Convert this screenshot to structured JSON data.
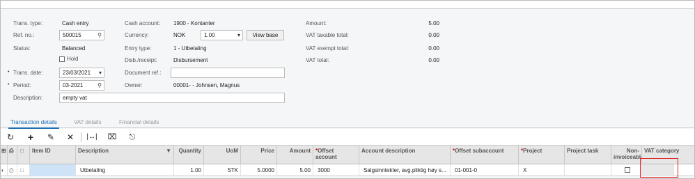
{
  "header": {
    "trans_type_label": "Trans. type:",
    "trans_type_value": "Cash entry",
    "ref_no_label": "Ref. no.:",
    "ref_no_value": "500015",
    "status_label": "Status:",
    "status_value": "Balanced",
    "hold_label": "Hold",
    "trans_date_label": "Trans. date:",
    "trans_date_value": "23/03/2021",
    "period_label": "Period:",
    "period_value": "03-2021",
    "description_label": "Description:",
    "description_value": "empty vat",
    "cash_account_label": "Cash account:",
    "cash_account_value": "1900 - Kontanter",
    "currency_label": "Currency:",
    "currency_value": "NOK",
    "currency_rate": "1.00",
    "view_base_label": "View base",
    "entry_type_label": "Entry type:",
    "entry_type_value": "1 - Utbetaling",
    "disb_receipt_label": "Disb./receipt:",
    "disb_receipt_value": "Disbursement",
    "document_ref_label": "Document ref.:",
    "document_ref_value": "",
    "owner_label": "Owner:",
    "owner_value": "00001- - Johnsen, Magnus"
  },
  "totals": {
    "amount_label": "Amount:",
    "amount_value": "5.00",
    "vat_taxable_label": "VAT taxable total:",
    "vat_taxable_value": "0.00",
    "vat_exempt_label": "VAT exempt total:",
    "vat_exempt_value": "0.00",
    "vat_total_label": "VAT total:",
    "vat_total_value": "0.00"
  },
  "tabs": [
    {
      "label": "Transaction details",
      "active": true
    },
    {
      "label": "VAT details",
      "active": false
    },
    {
      "label": "Financial details",
      "active": false
    }
  ],
  "toolbar": {
    "icons": [
      "refresh-icon",
      "add-icon",
      "edit-icon",
      "delete-icon",
      "fit-width-icon",
      "export-excel-icon",
      "upload-icon"
    ]
  },
  "grid": {
    "columns": {
      "item_id": "Item ID",
      "description": "Description",
      "quantity": "Quantity",
      "uom": "UoM",
      "price": "Price",
      "amount": "Amount",
      "offset_account": "Offset account",
      "account_description": "Account description",
      "offset_subaccount": "Offset subaccount",
      "project": "Project",
      "project_task": "Project task",
      "non_invoiceable": "Non-invoiceable",
      "vat_category": "VAT category"
    },
    "rows": [
      {
        "item_id": "",
        "description": "Utbetaling",
        "quantity": "1.00",
        "uom": "STK",
        "price": "5.0000",
        "amount": "5.00",
        "offset_account": "3000",
        "account_description": "Salgsinntekter, avg.pliktig høy s...",
        "offset_subaccount": "01-001-0",
        "project": "X",
        "project_task": "",
        "vat_category": ""
      }
    ]
  },
  "colors": {
    "accent": "#1f6fb4",
    "highlight_border": "#e02020",
    "selected_cell": "#cfe3f7"
  }
}
